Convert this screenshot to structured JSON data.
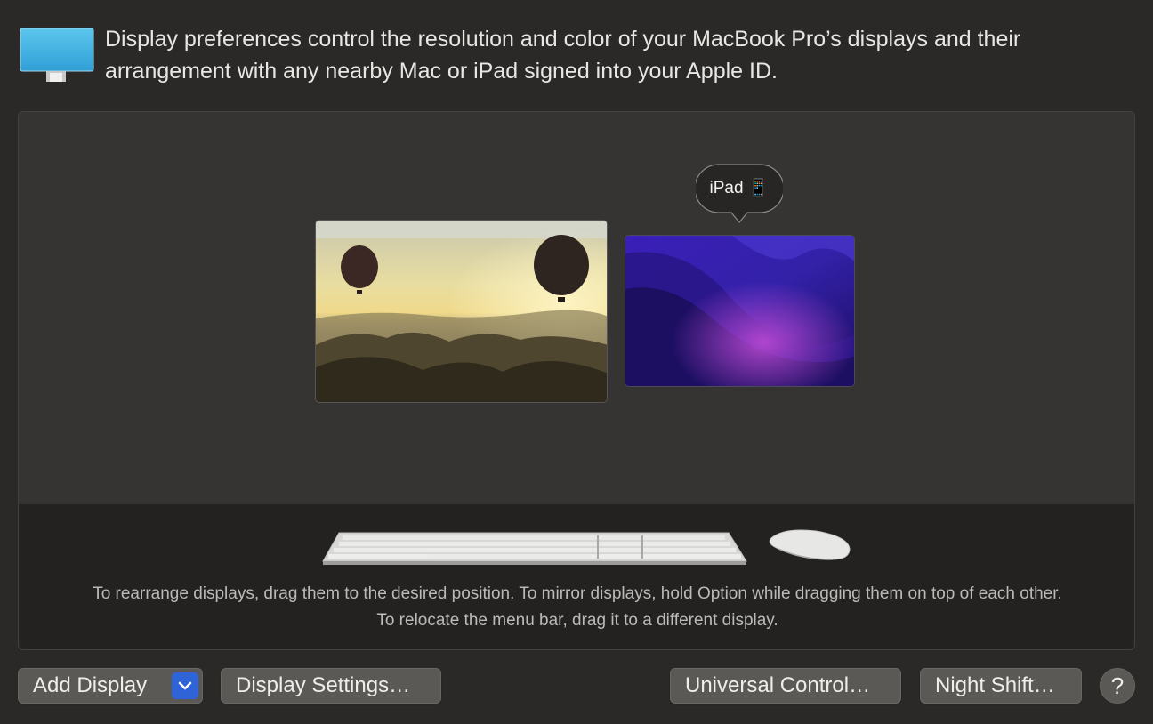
{
  "header": {
    "description": "Display preferences control the resolution and color of your MacBook Pro’s displays and their arrangement with any nearby Mac or iPad signed into your Apple ID."
  },
  "arrangement": {
    "ipad_label": "iPad 📱",
    "hint": "To rearrange displays, drag them to the desired position. To mirror displays, hold Option while dragging them on top of each other. To relocate the menu bar, drag it to a different display."
  },
  "buttons": {
    "add_display": "Add Display",
    "display_settings": "Display Settings…",
    "universal_control": "Universal Control…",
    "night_shift": "Night Shift…",
    "help": "?"
  },
  "colors": {
    "accent": "#2f64d9",
    "background": "#2b2927"
  },
  "icons": [
    "monitor-icon",
    "chevron-down-icon",
    "keyboard-icon",
    "mouse-icon"
  ]
}
